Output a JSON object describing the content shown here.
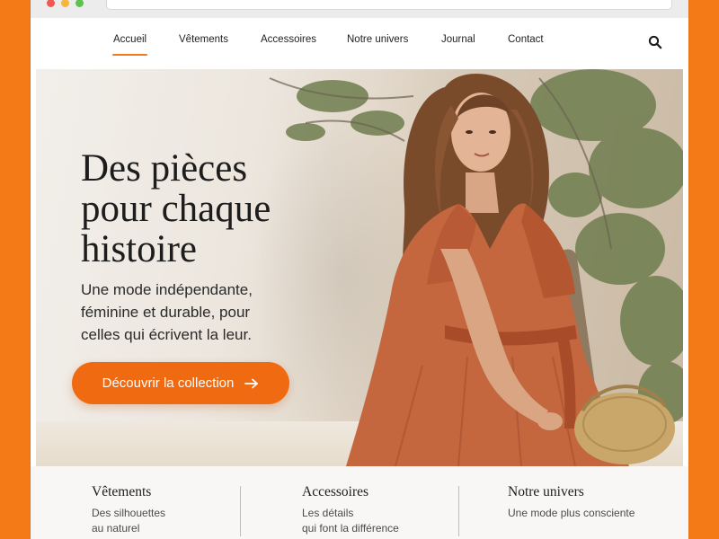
{
  "nav": {
    "items": [
      {
        "label": "Accueil",
        "active": true
      },
      {
        "label": "Vêtements"
      },
      {
        "label": "Accessoires"
      },
      {
        "label": "Notre univers"
      },
      {
        "label": "Journal"
      },
      {
        "label": "Contact"
      }
    ],
    "search_icon": "search-icon"
  },
  "hero": {
    "headline": [
      "Des pièces",
      "pour chaque",
      "histoire"
    ],
    "subtitle": [
      "Une mode indépendante,",
      "féminine et durable, pour",
      "celles qui écrivent la leur."
    ],
    "cta_label": "Découvrir la collection",
    "cta_icon": "arrow-right-icon"
  },
  "cards": [
    {
      "title": "Vêtements",
      "text": [
        "Des silhouettes",
        "au naturel"
      ]
    },
    {
      "title": "Accessoires",
      "text": [
        "Les détails",
        "qui font la différence"
      ]
    },
    {
      "title": "Notre univers",
      "text": [
        "Une mode plus consciente"
      ]
    }
  ],
  "colors": {
    "accent": "#f06a12",
    "frame": "#f47a17",
    "dress": "#c4673f"
  }
}
